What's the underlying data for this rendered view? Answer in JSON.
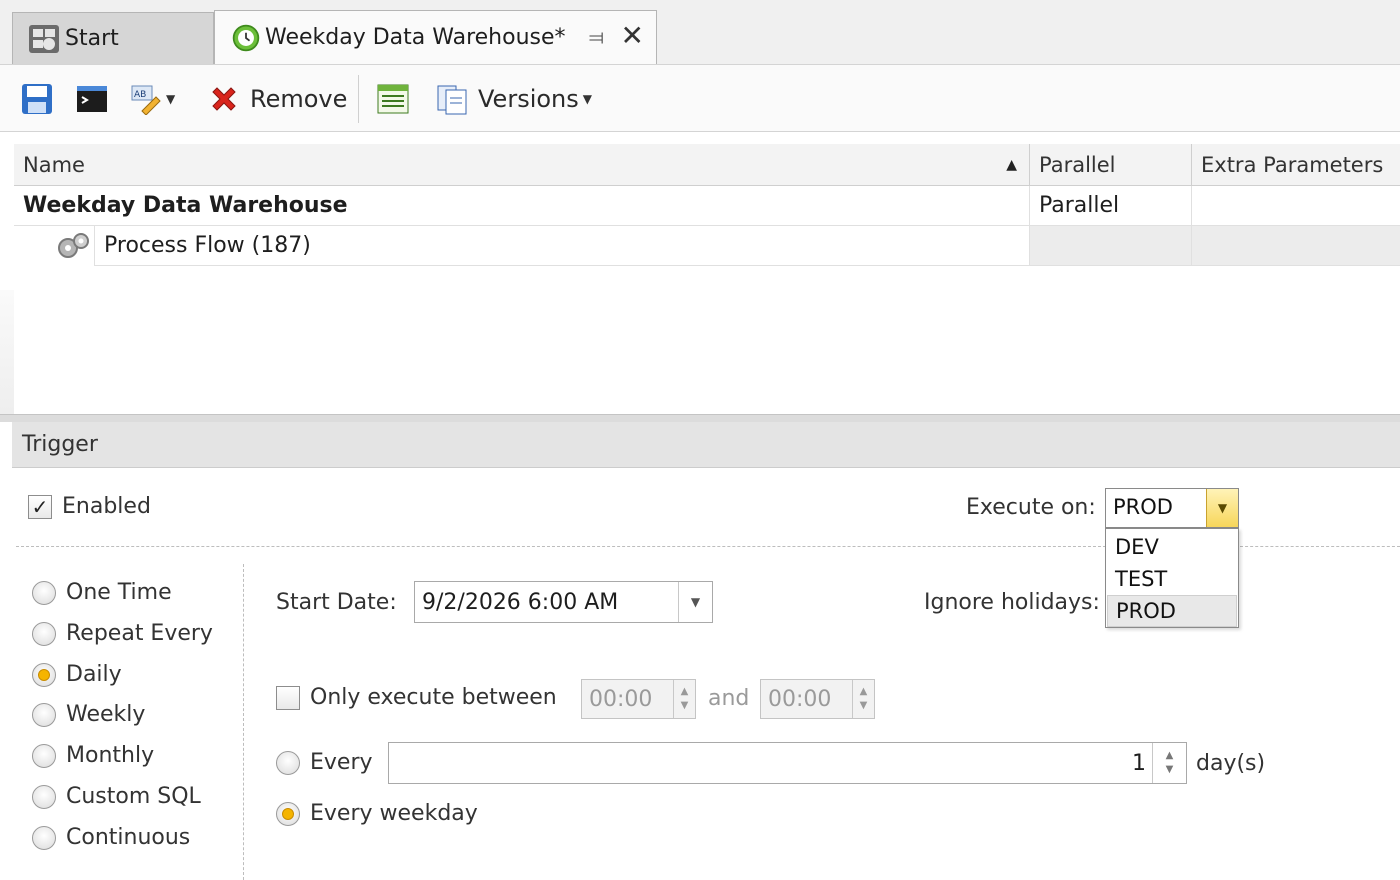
{
  "tabs": {
    "start": "Start",
    "document": "Weekday Data Warehouse*"
  },
  "toolbar": {
    "remove": "Remove",
    "versions": "Versions"
  },
  "grid": {
    "columns": [
      "Name",
      "Parallel",
      "Extra Parameters"
    ],
    "rows": [
      {
        "name": "Weekday Data Warehouse",
        "parallel": "Parallel",
        "extra": ""
      },
      {
        "name": "Process Flow (187)",
        "parallel": "",
        "extra": ""
      }
    ]
  },
  "trigger": {
    "title": "Trigger",
    "enabled_label": "Enabled",
    "enabled_checked": true,
    "execute_on_label": "Execute on:",
    "execute_on_value": "PROD",
    "execute_on_options": [
      "DEV",
      "TEST",
      "PROD"
    ],
    "schedule_types": [
      "One Time",
      "Repeat Every",
      "Daily",
      "Weekly",
      "Monthly",
      "Custom SQL",
      "Continuous"
    ],
    "selected_schedule": "Daily",
    "start_date_label": "Start Date:",
    "start_date_value": "9/2/2026 6:00 AM",
    "ignore_holidays_label": "Ignore holidays:",
    "only_between_label": "Only execute between",
    "only_between_checked": false,
    "between_from": "00:00",
    "between_and": "and",
    "between_to": "00:00",
    "every_label": "Every",
    "every_value": "1",
    "every_unit": "day(s)",
    "every_weekday_label": "Every weekday",
    "selected_daily_option": "Every weekday"
  },
  "colors": {
    "accent_radio": "#f5b400",
    "combo_button": "#f7d65a",
    "remove_icon": "#d9241c"
  }
}
